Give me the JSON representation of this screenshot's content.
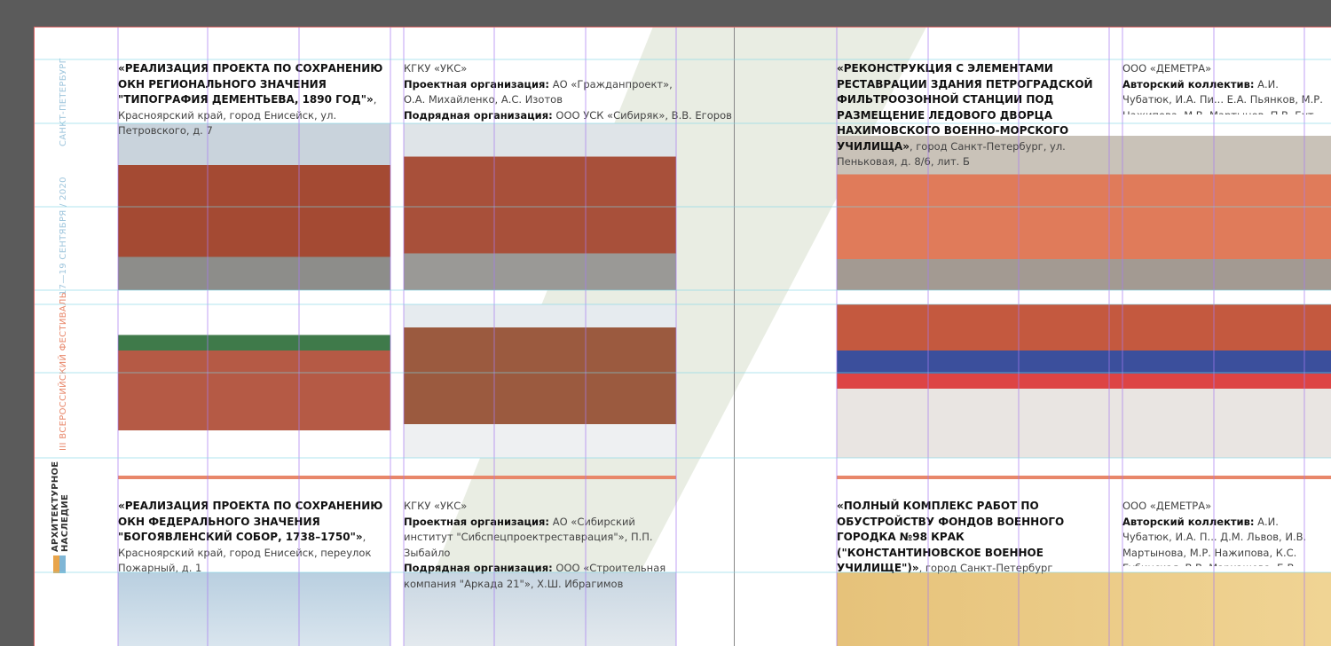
{
  "sidebar": {
    "city": "САНКТ-ПЕТЕРБУРГ",
    "dates": "17—19 СЕНТЯБРЯ / 2020",
    "festival": "III ВСЕРОССИЙСКИЙ ФЕСТИВАЛЬ",
    "logo_line1": "АРХИТЕКТУРНОЕ",
    "logo_line2": "НАСЛЕДИЕ"
  },
  "projects": [
    {
      "title": "«РЕАЛИЗАЦИЯ ПРОЕКТА ПО СОХРАНЕНИЮ ОКН РЕГИОНАЛЬНОГО ЗНАЧЕНИЯ \"ТИПОГРАФИЯ ДЕМЕНТЬЕВА, 1890 ГОД\"»",
      "location": ", Красноярский край, город Енисейск, ул. Петровского, д. 7",
      "client": "КГКУ «УКС»",
      "l1": "Проектная организация:",
      "v1": " АО «Гражданпроект», О.А. Михайленко, А.С. Изотов",
      "l2": "Подрядная организация:",
      "v2": " ООО УСК «Сибиряк», В.В. Егоров"
    },
    {
      "title": "«РЕКОНСТРУКЦИЯ С ЭЛЕМЕНТАМИ РЕСТАВРАЦИИ ЗДАНИЯ ПЕТРОГРАДСКОЙ ФИЛЬТРООЗОННОЙ СТАНЦИИ ПОД РАЗМЕЩЕНИЕ ЛЕДОВОГО ДВОРЦА НАХИМОВСКОГО ВОЕННО-МОРСКОГО УЧИЛИЩА»",
      "location": ", город Санкт-Петербург, ул. Пеньковая, д. 8/6, лит. Б",
      "client": "ООО «ДЕМЕТРА»",
      "l1": "Авторский коллектив:",
      "v1": " А.И. Чубатюк, И.А. Пи... Е.А. Пьянков, М.Р. Нажипова, М.В. Мартынов, П.В. Бут-Вечерко, А.Г. Чунин, В.В. Смирнов"
    },
    {
      "title": "«РЕАЛИЗАЦИЯ ПРОЕКТА ПО СОХРАНЕНИЮ ОКН ФЕДЕРАЛЬНОГО ЗНАЧЕНИЯ \"БОГОЯВЛЕНСКИЙ СОБОР, 1738–1750\"»",
      "location": ", Красноярский край, город Енисейск, переулок Пожарный, д. 1",
      "client": "КГКУ «УКС»",
      "l1": "Проектная организация:",
      "v1": " АО «Сибирский институт \"Сибспецпроектреставрация\"», П.П. Зыбайло",
      "l2": "Подрядная организация:",
      "v2": " ООО «Строительная компания \"Аркада 21\"», Х.Ш. Ибрагимов"
    },
    {
      "title": "«ПОЛНЫЙ КОМПЛЕКС РАБОТ ПО ОБУСТРОЙСТВУ ФОНДОВ ВОЕННОГО ГОРОДКА №98 КРАК (\"КОНСТАНТИНОВСКОЕ ВОЕННОЕ УЧИЛИЩЕ\")»",
      "location": ", город Санкт-Петербург",
      "client": "ООО «ДЕМЕТРА»",
      "l1": "Авторский коллектив:",
      "v1": " А.И. Чубатюк, И.А. П... Д.М. Львов, И.В. Мартынова, М.Р. Нажипова, К.С. Губинская, В.В. Мархашова, Б.В. Иевлев, А.Г. Михович, А.В. Стремецкий"
    }
  ],
  "colors": {
    "accent": "#e8876a",
    "stripe": "#e9ede3",
    "pasteboard": "#5b5b5b"
  }
}
